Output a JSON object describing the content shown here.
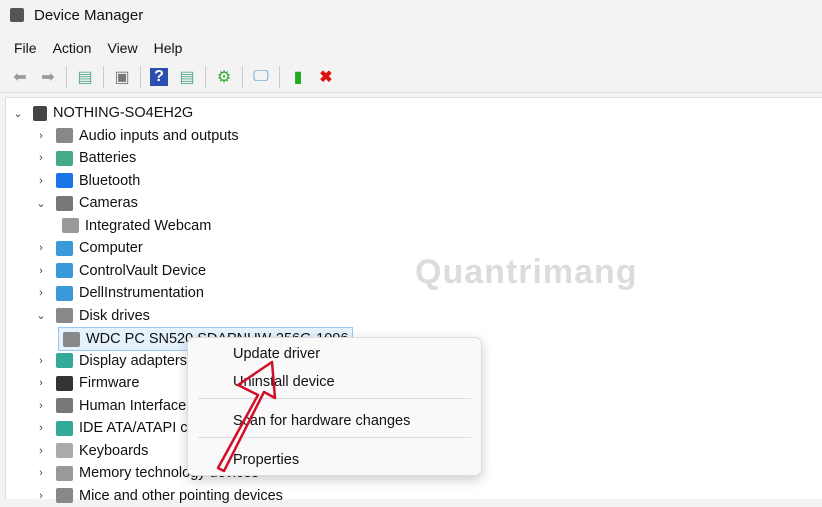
{
  "window": {
    "title": "Device Manager"
  },
  "menubar": [
    "File",
    "Action",
    "View",
    "Help"
  ],
  "toolbar": [
    {
      "icon": "back-icon"
    },
    {
      "icon": "forward-icon"
    },
    {
      "icon": "show-hide-tree-icon"
    },
    {
      "icon": "properties-icon"
    },
    {
      "icon": "help-icon"
    },
    {
      "icon": "action-pane-icon"
    },
    {
      "icon": "update-driver-icon"
    },
    {
      "icon": "scan-hardware-icon"
    },
    {
      "icon": "enable-device-icon"
    },
    {
      "icon": "uninstall-icon"
    }
  ],
  "tree": {
    "root": "NOTHING-SO4EH2G",
    "items": [
      {
        "label": "Audio inputs and outputs",
        "expanded": false,
        "color": "#888"
      },
      {
        "label": "Batteries",
        "expanded": false,
        "color": "#4a8"
      },
      {
        "label": "Bluetooth",
        "expanded": false,
        "color": "#1b73e8"
      },
      {
        "label": "Cameras",
        "expanded": true,
        "color": "#777"
      },
      {
        "label": "Integrated Webcam",
        "child": true,
        "color": "#999"
      },
      {
        "label": "Computer",
        "expanded": false,
        "color": "#3a9ad9"
      },
      {
        "label": "ControlVault Device",
        "expanded": false,
        "color": "#3a9ad9"
      },
      {
        "label": "DellInstrumentation",
        "expanded": false,
        "color": "#3a9ad9"
      },
      {
        "label": "Disk drives",
        "expanded": true,
        "color": "#888"
      },
      {
        "label": "WDC PC SN520 SDAPNUW-256G-1006",
        "child": true,
        "selected": true,
        "color": "#888"
      },
      {
        "label": "Display adapters",
        "expanded": false,
        "color": "#3a9"
      },
      {
        "label": "Firmware",
        "expanded": false,
        "color": "#333"
      },
      {
        "label": "Human Interface Devices",
        "expanded": false,
        "color": "#777"
      },
      {
        "label": "IDE ATA/ATAPI controllers",
        "expanded": false,
        "color": "#3a9"
      },
      {
        "label": "Keyboards",
        "expanded": false,
        "color": "#aaa"
      },
      {
        "label": "Memory technology devices",
        "expanded": false,
        "color": "#999"
      },
      {
        "label": "Mice and other pointing devices",
        "expanded": false,
        "color": "#888"
      }
    ]
  },
  "context_menu": {
    "items": [
      "Update driver",
      "Uninstall device",
      "Scan for hardware changes",
      "Properties"
    ]
  },
  "watermark": "Quantrimang",
  "colors": {
    "arrow": "#d0102a",
    "selection": "#e5f1fb"
  }
}
